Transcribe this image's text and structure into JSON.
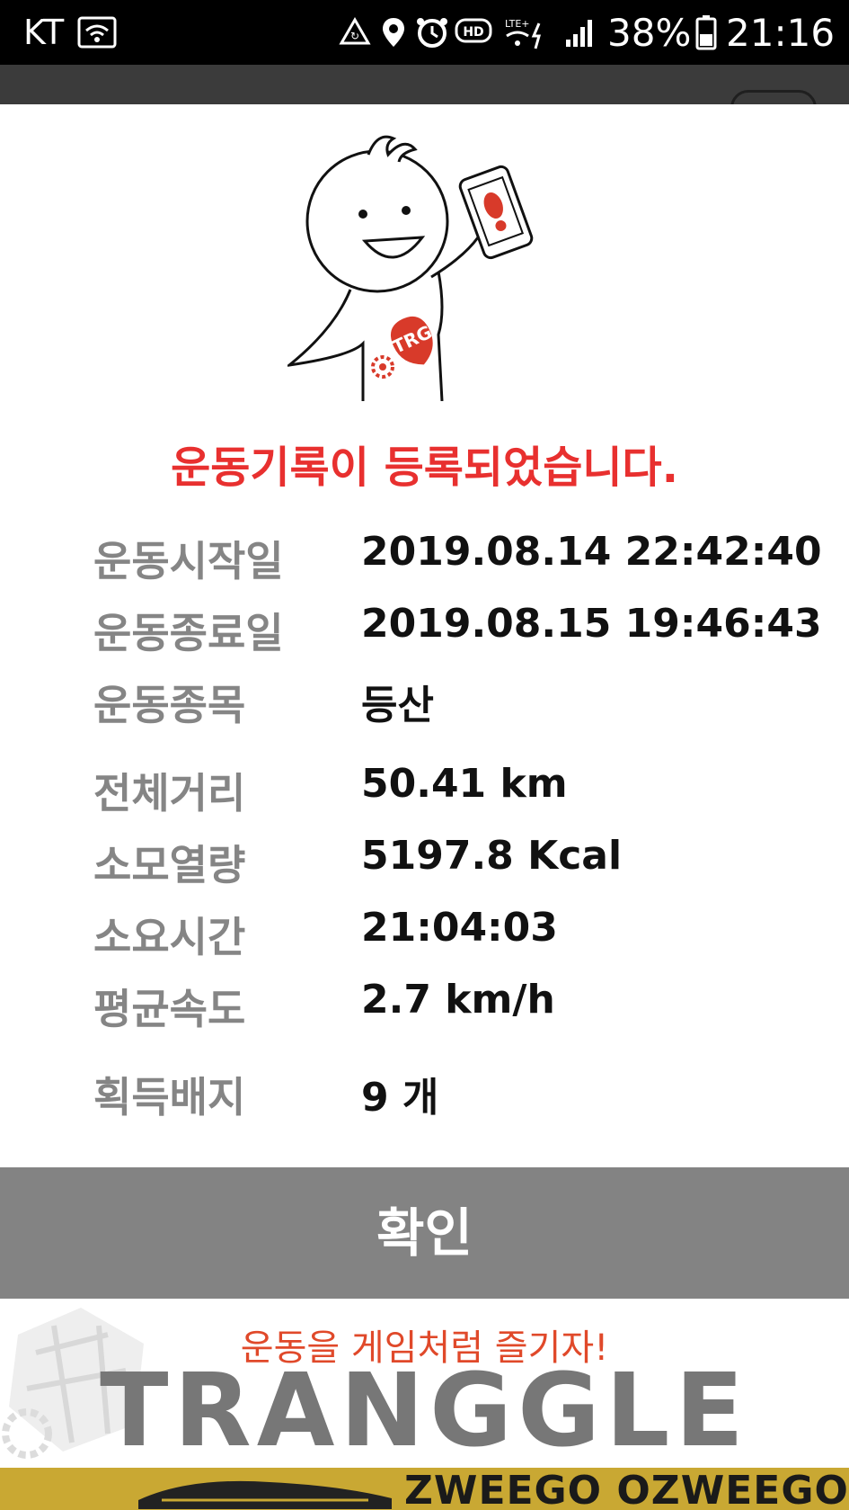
{
  "status_bar": {
    "carrier": "KT",
    "battery_percent": "38%",
    "time": "21:16",
    "icons": [
      "wifi-icon",
      "sync-icon",
      "location-icon",
      "alarm-icon",
      "hd-icon",
      "lte-icon",
      "signal-icon",
      "battery-icon"
    ]
  },
  "dialog": {
    "mascot_badge": "TRG",
    "title": "운동기록이 등록되었습니다.",
    "rows": [
      {
        "label": "운동시작일",
        "value": "2019.08.14 22:42:40"
      },
      {
        "label": "운동종료일",
        "value": "2019.08.15 19:46:43"
      },
      {
        "label": "운동종목",
        "value": "등산"
      },
      {
        "label": "전체거리",
        "value": "50.41 km"
      },
      {
        "label": "소모열량",
        "value": "5197.8 Kcal"
      },
      {
        "label": "소요시간",
        "value": "21:04:03"
      },
      {
        "label": "평균속도",
        "value": "2.7 km/h"
      },
      {
        "label": "획득배지",
        "value": "9 개"
      }
    ],
    "confirm_label": "확인"
  },
  "ad_banner": {
    "tagline": "운동을 게임처럼 즐기자!",
    "logo": "TRANGGLE"
  },
  "bottom_ad": {
    "text": "ZWEEGO OZWEEGO"
  },
  "colors": {
    "accent_red": "#e8302f",
    "label_gray": "#858585",
    "button_gray": "#838383",
    "logo_gray": "#777777"
  }
}
